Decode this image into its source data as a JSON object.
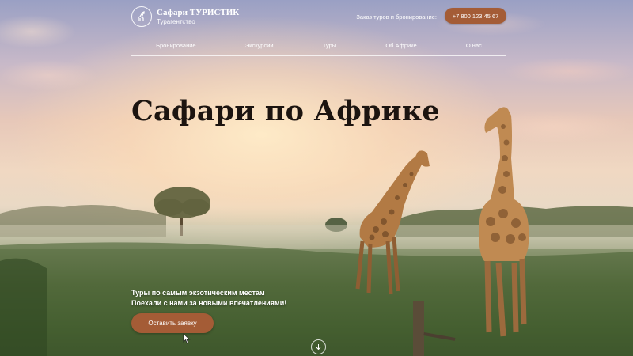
{
  "header": {
    "brand_name": "Сафари ТУРИСТИК",
    "brand_sub": "Турагентство",
    "order_label": "Заказ туров и бронирование:",
    "phone": "+7 800 123 45 67"
  },
  "nav": {
    "items": [
      "Бронирование",
      "Экскурсии",
      "Туры",
      "Об Африке",
      "О нас"
    ]
  },
  "hero": {
    "title": "Сафари по Африке",
    "tagline_line1": "Туры по самым экзотическим местам",
    "tagline_line2": "Поехали с нами за новыми впечатлениями!",
    "cta_label": "Оставить заявку"
  },
  "icons": {
    "logo": "giraffe-icon",
    "scroll": "arrow-down-icon"
  },
  "colors": {
    "accent": "#a45c36",
    "title": "#1c1410"
  }
}
